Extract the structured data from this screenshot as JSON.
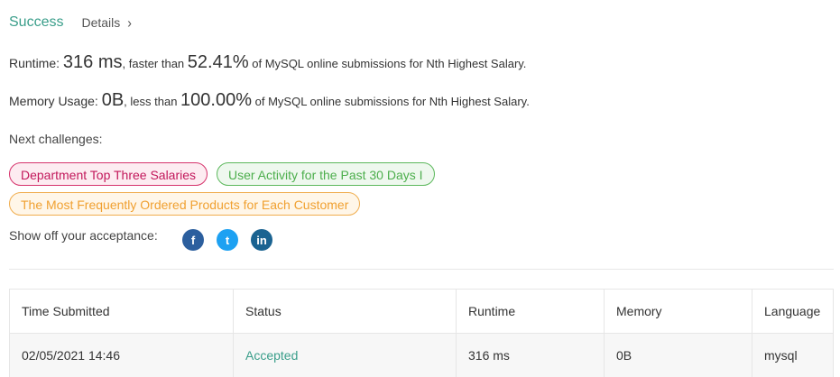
{
  "header": {
    "status": "Success",
    "details_label": "Details",
    "details_chevron": "›"
  },
  "runtime": {
    "label": "Runtime: ",
    "value": "316 ms",
    "faster_than": ", faster than ",
    "percent": "52.41%",
    "suffix": " of MySQL online submissions for Nth Highest Salary."
  },
  "memory": {
    "label": "Memory Usage: ",
    "value": "0B",
    "less_than": ", less than ",
    "percent": "100.00%",
    "suffix": " of MySQL online submissions for Nth Highest Salary."
  },
  "next_challenges": {
    "label": "Next challenges:",
    "items": [
      {
        "title": "Department Top Three Salaries",
        "difficulty_color": "#c2185b"
      },
      {
        "title": "User Activity for the Past 30 Days I",
        "difficulty_color": "#4cae4c"
      },
      {
        "title": "The Most Frequently Ordered Products for Each Customer",
        "difficulty_color": "#f0a030"
      }
    ]
  },
  "share": {
    "label": "Show off your acceptance:",
    "icons": [
      {
        "name": "facebook-icon",
        "glyph": "f"
      },
      {
        "name": "twitter-icon",
        "glyph": "t"
      },
      {
        "name": "linkedin-icon",
        "glyph": "in"
      }
    ]
  },
  "submissions_table": {
    "headers": [
      "Time Submitted",
      "Status",
      "Runtime",
      "Memory",
      "Language"
    ],
    "rows": [
      {
        "time": "02/05/2021 14:46",
        "status": "Accepted",
        "runtime": "316 ms",
        "memory": "0B",
        "language": "mysql"
      }
    ]
  },
  "colors": {
    "accent": "#3a9e8a"
  }
}
